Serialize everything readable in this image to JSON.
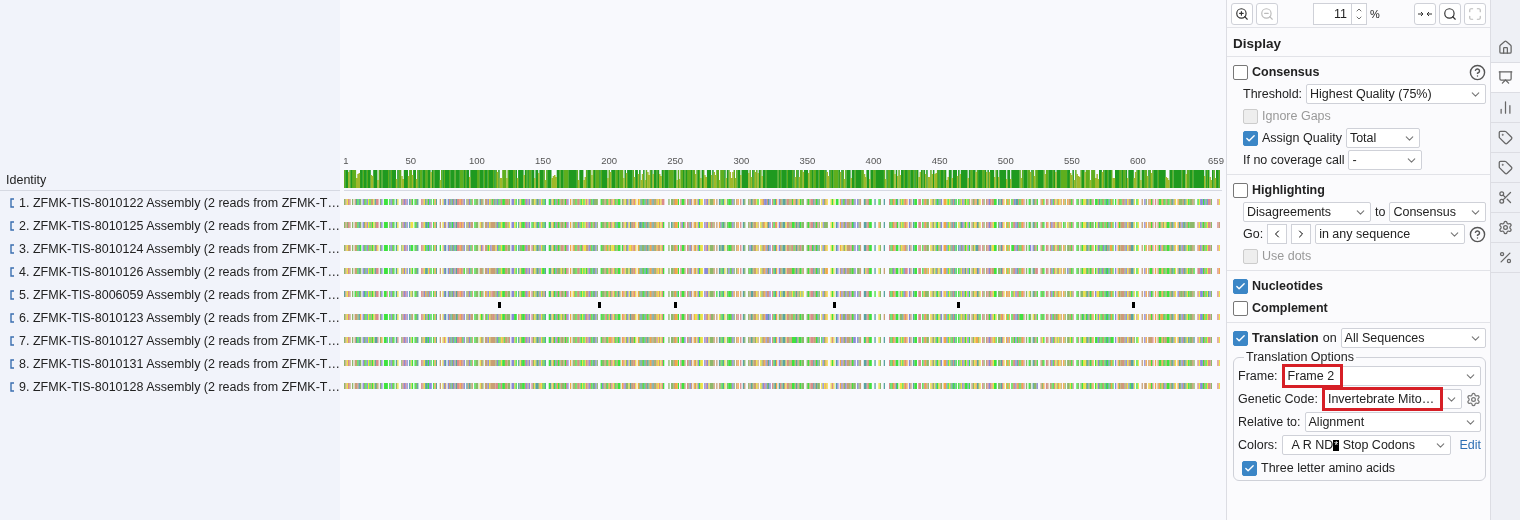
{
  "toolbar": {
    "zoom": "11",
    "zoom_unit": "%"
  },
  "alignment": {
    "header": "Identity",
    "ruler": [
      "1",
      "50",
      "100",
      "150",
      "200",
      "250",
      "300",
      "350",
      "400",
      "450",
      "500",
      "550",
      "600",
      "659"
    ],
    "sequences": [
      {
        "name": "1. ZFMK-TIS-8010122 Assembly (2 reads from ZFMK-T…"
      },
      {
        "name": "2. ZFMK-TIS-8010125 Assembly (2 reads from ZFMK-T…"
      },
      {
        "name": "3. ZFMK-TIS-8010124 Assembly (2 reads from ZFMK-T…"
      },
      {
        "name": "4. ZFMK-TIS-8010126 Assembly (2 reads from ZFMK-T…"
      },
      {
        "name": "5. ZFMK-TIS-8006059 Assembly (2 reads from ZFMK-T…"
      },
      {
        "name": "6. ZFMK-TIS-8010123 Assembly (2 reads from ZFMK-T…"
      },
      {
        "name": "7. ZFMK-TIS-8010127 Assembly (2 reads from ZFMK-T…"
      },
      {
        "name": "8. ZFMK-TIS-8010131 Assembly (2 reads from ZFMK-T…"
      },
      {
        "name": "9. ZFMK-TIS-8010128 Assembly (2 reads from ZFMK-T…"
      }
    ]
  },
  "panel": {
    "title": "Display",
    "consensus": {
      "label": "Consensus",
      "checked": false,
      "threshold_label": "Threshold:",
      "threshold": "Highest Quality (75%)",
      "ignore_gaps": {
        "label": "Ignore Gaps",
        "checked": false,
        "disabled": true
      },
      "assign_quality": {
        "label": "Assign Quality",
        "checked": true,
        "value": "Total"
      },
      "no_coverage_label": "If no coverage call",
      "no_coverage": "-"
    },
    "highlighting": {
      "label": "Highlighting",
      "checked": false,
      "mode": "Disagreements",
      "to_label": "to",
      "target": "Consensus",
      "go_label": "Go:",
      "scope": "in any sequence",
      "use_dots": {
        "label": "Use dots",
        "checked": false,
        "disabled": true
      }
    },
    "nucleotides": {
      "label": "Nucleotides",
      "checked": true
    },
    "complement": {
      "label": "Complement",
      "checked": false
    },
    "translation": {
      "label": "Translation",
      "checked": true,
      "on_label": "on",
      "target": "All Sequences",
      "options": {
        "title": "Translation Options",
        "frame_label": "Frame:",
        "frame": {
          "value": "Frame 2",
          "highlighted": true
        },
        "genetic_code_label": "Genetic Code:",
        "genetic_code": {
          "value": "Invertebrate Mito…",
          "highlighted": true
        },
        "relative_label": "Relative to:",
        "relative": "Alignment",
        "colors_label": "Colors:",
        "colors_sample": "A R ND",
        "colors_stop": "*",
        "colors_value": "Stop Codons",
        "edit": "Edit",
        "three_letter": {
          "label": "Three letter amino acids",
          "checked": true
        }
      }
    }
  },
  "side_tabs": [
    {
      "kind": "home",
      "selected": false
    },
    {
      "kind": "display",
      "selected": true
    },
    {
      "kind": "stats",
      "selected": false
    },
    {
      "kind": "tag",
      "selected": false
    },
    {
      "kind": "tag",
      "selected": false
    },
    {
      "kind": "cut",
      "selected": false
    },
    {
      "kind": "settings",
      "selected": false
    },
    {
      "kind": "percent",
      "selected": false
    }
  ]
}
